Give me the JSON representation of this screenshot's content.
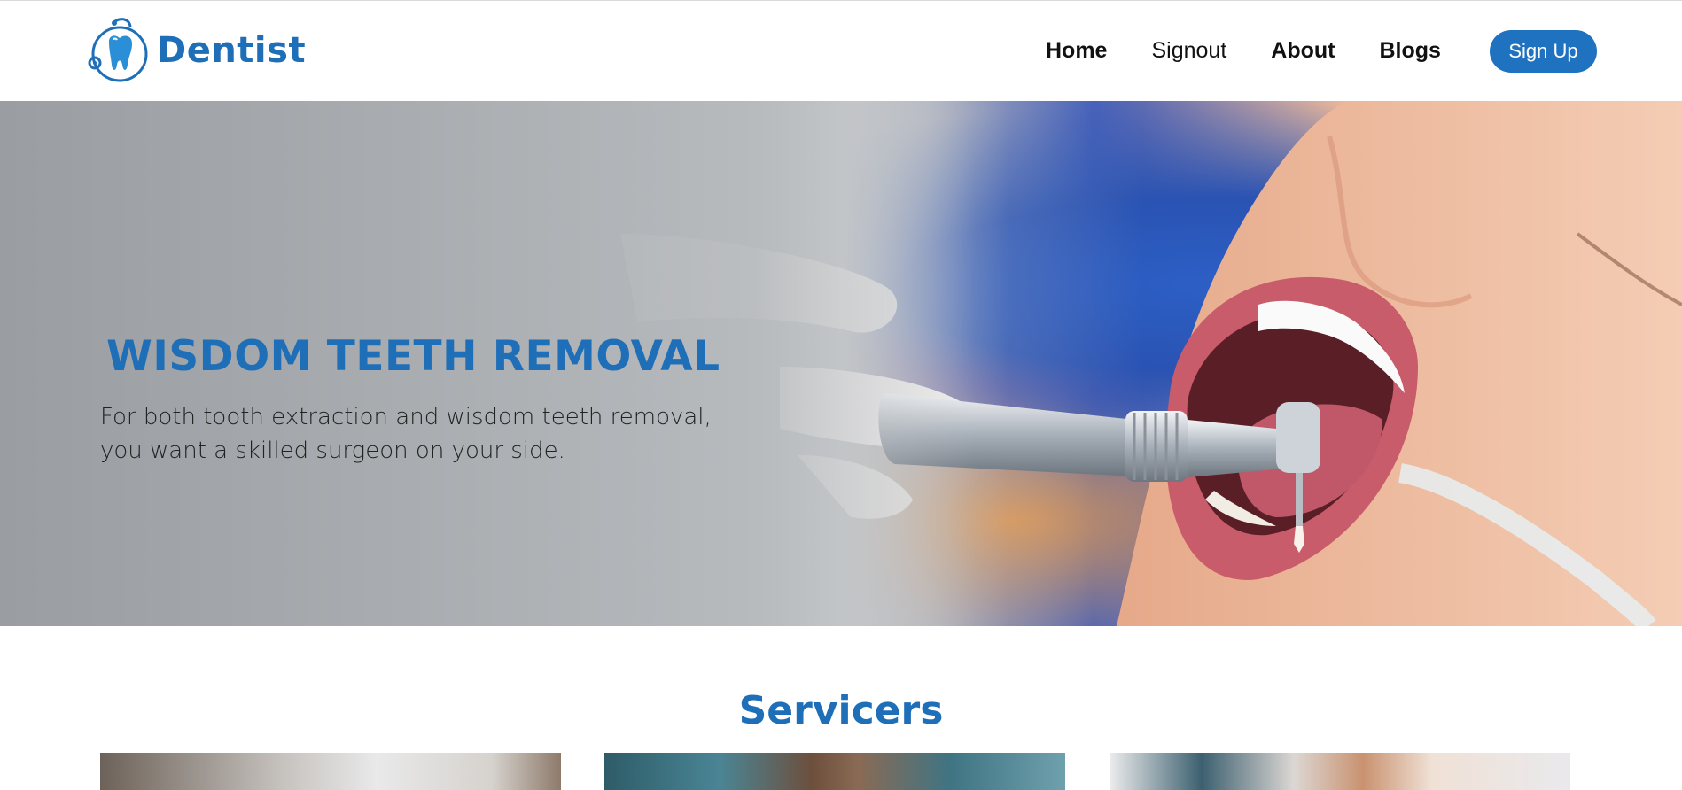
{
  "brand": {
    "name": "Dentist",
    "color": "#1f6fb8"
  },
  "nav": {
    "items": [
      {
        "label": "Home"
      },
      {
        "label": "Signout"
      },
      {
        "label": "About"
      },
      {
        "label": "Blogs"
      }
    ],
    "signup_label": "Sign Up",
    "signup_color": "#1f72c0"
  },
  "hero": {
    "title": "WISDOM TEETH REMOVAL",
    "subtitle_line1": "For both tooth extraction and wisdom teeth removal,",
    "subtitle_line2": "you want a skilled surgeon on your side."
  },
  "services": {
    "title": "Servicers"
  }
}
